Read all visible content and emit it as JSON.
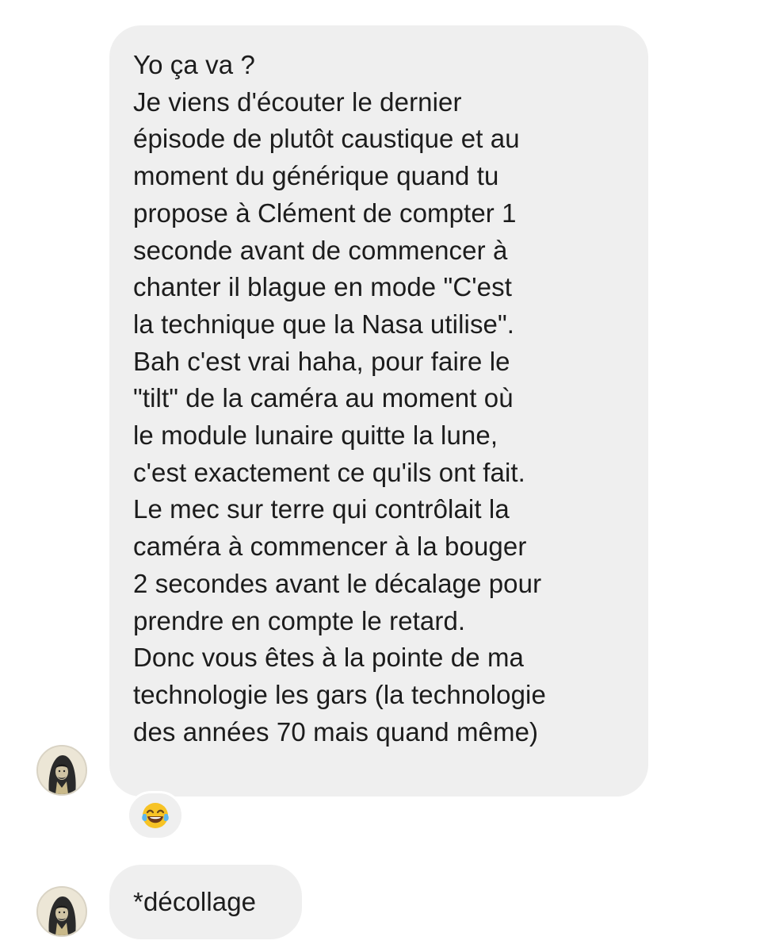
{
  "conversation": {
    "messages": [
      {
        "sender": "other",
        "lines": [
          "Yo ça va ?",
          "Je viens d'écouter le dernier",
          "épisode de plutôt caustique et au",
          "moment du générique quand tu",
          "propose à Clément de compter 1",
          "seconde avant de commencer à",
          "chanter il blague en mode \"C'est",
          "la technique que la Nasa utilise\".",
          "Bah c'est vrai haha, pour faire le",
          "\"tilt\" de la caméra au moment où",
          "le module lunaire quitte la lune,",
          "c'est exactement ce qu'ils ont fait.",
          "Le mec sur terre qui contrôlait la",
          "caméra à commencer à la bouger",
          "2 secondes avant le décalage pour",
          "prendre en compte le retard.",
          "Donc vous êtes à la pointe de ma",
          "technologie les gars (la technologie",
          "des années 70 mais quand même)"
        ],
        "reaction": {
          "icon": "face-with-tears-of-joy-icon",
          "color": "#f7c325"
        }
      },
      {
        "sender": "other",
        "lines": [
          "*décollage"
        ]
      }
    ],
    "avatar": {
      "icon": "hooded-figure-avatar-icon",
      "background": "#e8e2d2"
    }
  },
  "colors": {
    "bubble": "#efefef",
    "text": "#1c1c1c",
    "background": "#ffffff"
  }
}
